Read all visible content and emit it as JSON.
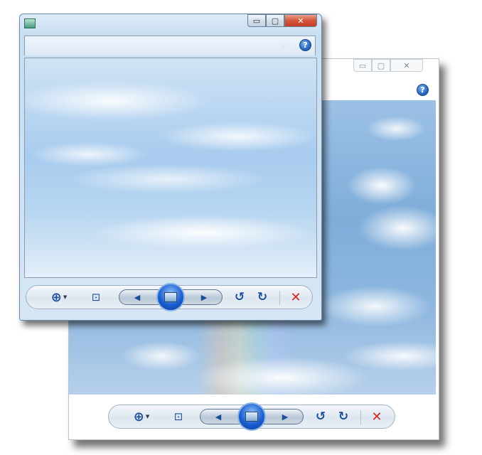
{
  "back_window": {
    "caption": {
      "minimize": "▭",
      "maximize": "▢",
      "close": "✕"
    },
    "help": "?"
  },
  "front_window": {
    "caption": {
      "minimize": "▭",
      "maximize": "▢",
      "close": "✕"
    },
    "help": "?",
    "chevron": "»"
  },
  "controls": {
    "zoom": "⊕",
    "zoom_dropdown": "▼",
    "fit": "⊡",
    "previous": "◀",
    "next": "▶",
    "rotate_ccw": "↺",
    "rotate_cw": "↻",
    "delete": "✕"
  },
  "colors": {
    "accent": "#1d4f9a",
    "delete": "#d02a1a",
    "close_button": "#c13d24"
  }
}
